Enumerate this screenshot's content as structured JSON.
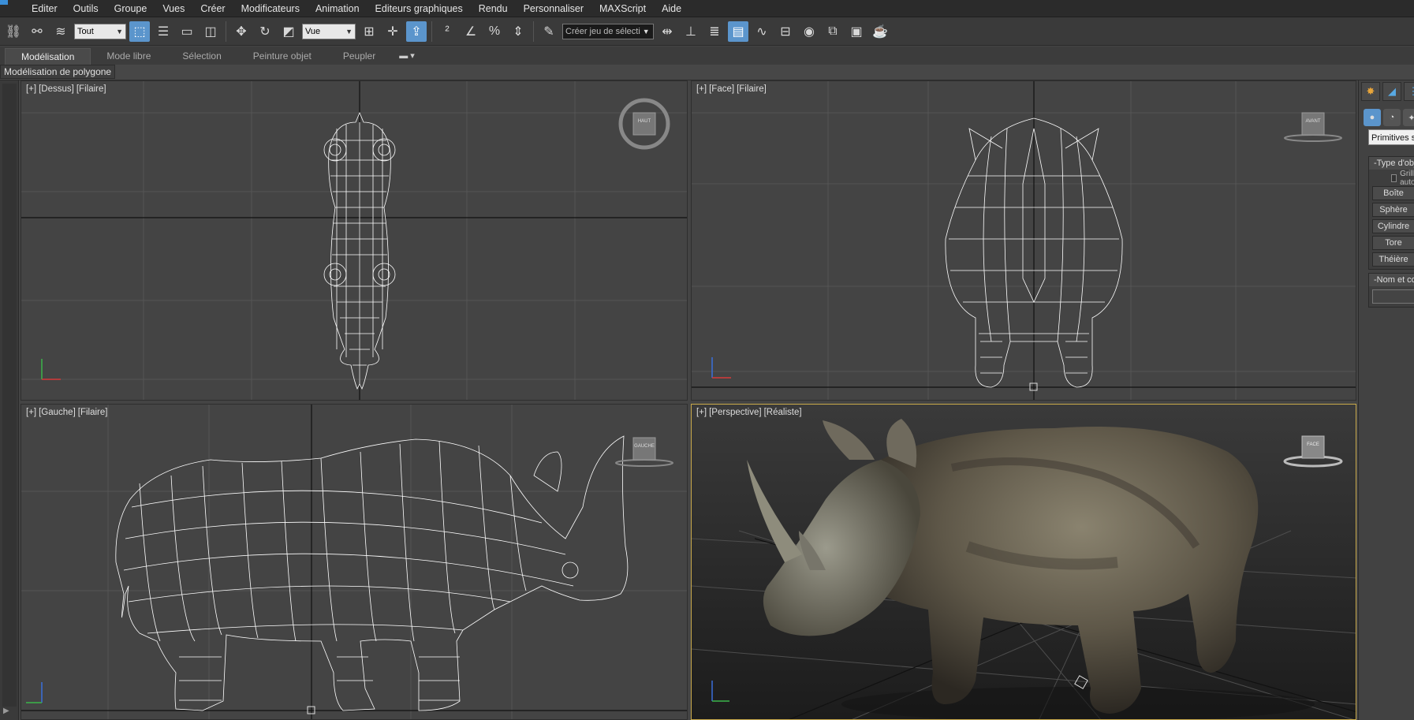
{
  "menubar": {
    "items": [
      "Editer",
      "Outils",
      "Groupe",
      "Vues",
      "Créer",
      "Modificateurs",
      "Animation",
      "Editeurs graphiques",
      "Rendu",
      "Personnaliser",
      "MAXScript",
      "Aide"
    ]
  },
  "toolbar": {
    "selection_filter": "Tout",
    "reference_coord": "Vue",
    "named_selection_placeholder": "Créer jeu de sélecti"
  },
  "ribbon": {
    "tabs": [
      "Modélisation",
      "Mode libre",
      "Sélection",
      "Peinture objet",
      "Peupler"
    ],
    "active_tab": "Modélisation",
    "extra": "▾",
    "sub_label": "Modélisation de polygone"
  },
  "viewports": {
    "top": {
      "plus": "[+]",
      "view": "[Dessus]",
      "shading": "[Filaire]",
      "cube_label": "HAUT"
    },
    "front": {
      "plus": "[+]",
      "view": "[Face]",
      "shading": "[Filaire]",
      "cube_label": "AVANT"
    },
    "left": {
      "plus": "[+]",
      "view": "[Gauche]",
      "shading": "[Filaire]",
      "cube_label": "GAUCHE"
    },
    "persp": {
      "plus": "[+]",
      "view": "[Perspective]",
      "shading": "[Réaliste]",
      "cube_label": "FACE"
    }
  },
  "command_panel": {
    "category_dropdown": "Primitives standard",
    "object_type_header": "Type d'objet",
    "object_type_prefix": "-",
    "grid_checkbox": "Grille auto",
    "buttons": [
      "Boîte",
      "Sphère",
      "Cylindre",
      "Tore",
      "Théière"
    ],
    "name_header": "Nom et couleur",
    "name_prefix": "-"
  },
  "colors": {
    "active_button": "#5b95cc",
    "viewport_bg": "#444444",
    "active_viewport_border": "#c9a94a",
    "wireframe": "#ffffff"
  }
}
